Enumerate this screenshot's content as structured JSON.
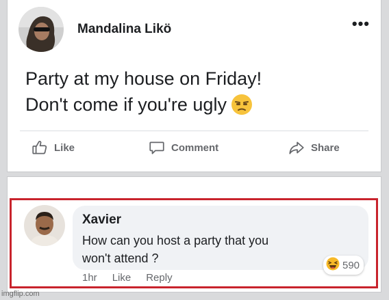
{
  "post": {
    "author_name": "Mandalina Likö",
    "more_label": "•••",
    "text_line1": "Party at my house on Friday!",
    "text_line2": "Don't come if you're ugly",
    "emoji_icon": "unamused-face-icon",
    "actions": {
      "like_label": "Like",
      "comment_label": "Comment",
      "share_label": "Share"
    }
  },
  "comment": {
    "name": "Xavier",
    "text_line1": "How can you host a party that you",
    "text_line2": "won't attend ?",
    "reaction_icon": "haha-laughing-icon",
    "reaction_count": "590",
    "time": "1hr",
    "like_label": "Like",
    "reply_label": "Reply"
  },
  "colors": {
    "highlight": "#c8232c",
    "bubble": "#f0f2f5",
    "muted_text": "#65676b"
  },
  "watermark": "imgflip.com"
}
